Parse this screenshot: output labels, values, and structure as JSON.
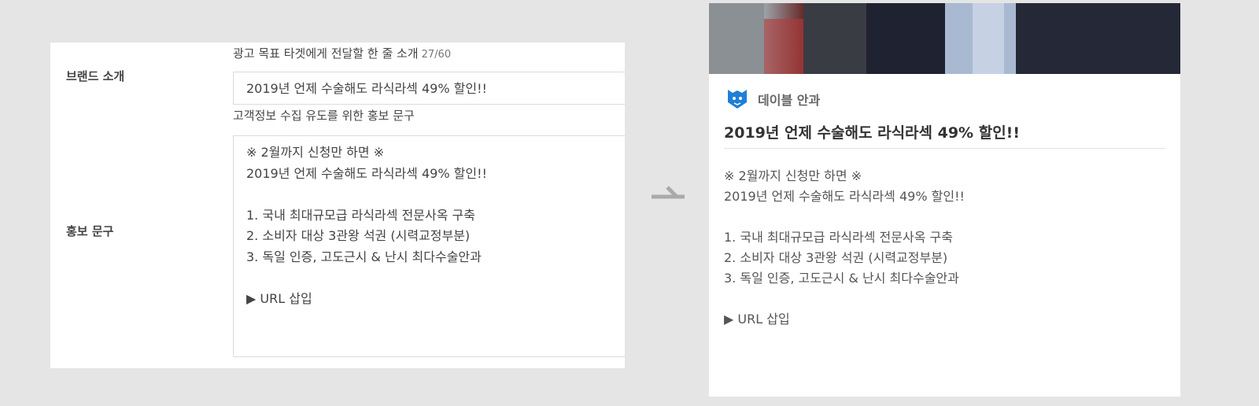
{
  "form": {
    "brand_intro": {
      "label": "브랜드 소개",
      "helper": "광고 목표 타겟에게 전달할 한 줄 소개",
      "count": "27/60",
      "value": "2019년 언제 수술해도 라식라섹 49% 할인!!"
    },
    "promo": {
      "label": "홍보 문구",
      "helper": "고객정보 수집 유도를 위한 홍보 문구",
      "lines": [
        "※ 2월까지 신청만 하면 ※",
        "2019년 언제 수술해도 라식라섹 49% 할인!!",
        "",
        "1. 국내 최대규모급 라식라섹 전문사옥 구축",
        "2. 소비자 대상 3관왕 석권 (시력교정부분)",
        "3. 독일 인증, 고도근시 & 난시 최다수술안과",
        "",
        "▶ URL 삽입"
      ]
    }
  },
  "arrow_icon": "arrow-right-icon",
  "preview": {
    "brand_icon": "fox-logo-icon",
    "brand_name": "데이블 안과",
    "title": "2019년 언제 수술해도 라식라섹 49% 할인!!",
    "body_lines": [
      "※ 2월까지 신청만 하면 ※",
      "2019년 언제 수술해도 라식라섹 49% 할인!!",
      "",
      "1. 국내 최대규모급 라식라섹 전문사옥 구축",
      "2. 소비자 대상 3관왕 석권 (시력교정부분)",
      "3. 독일 인증, 고도근시 & 난시 최다수술안과",
      "",
      "▶ URL 삽입"
    ]
  },
  "colors": {
    "background": "#e5e5e5",
    "panel": "#ffffff",
    "border": "#dcdcdc",
    "spell_underline": "#e23b3b",
    "logo_blue": "#1e7fd6",
    "arrow": "#aaaaaa"
  }
}
